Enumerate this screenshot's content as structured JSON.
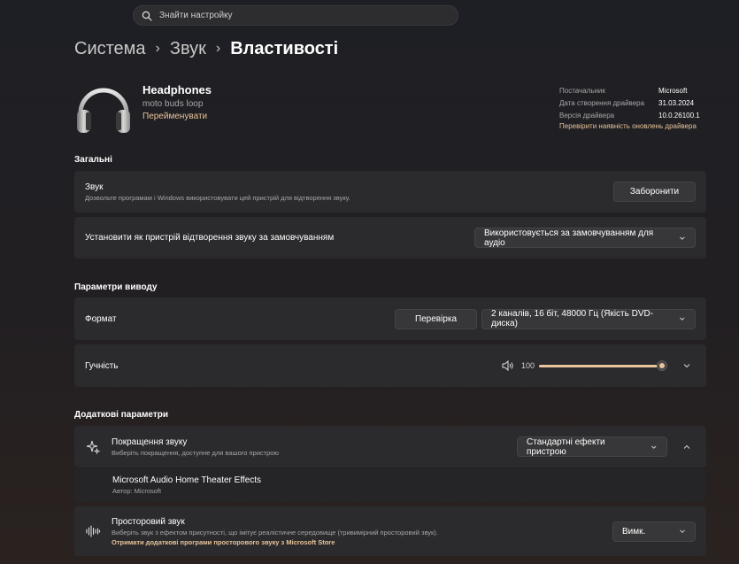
{
  "search": {
    "placeholder": "Знайти настройку"
  },
  "breadcrumb": {
    "level1": "Система",
    "level2": "Звук",
    "current": "Властивості"
  },
  "device": {
    "name": "Headphones",
    "model": "moto buds loop",
    "rename_link": "Перейменувати",
    "icon": "headphones-icon"
  },
  "driver": {
    "rows": [
      {
        "label": "Постачальник",
        "value": "Microsoft"
      },
      {
        "label": "Дата створення драйвера",
        "value": "31.03.2024"
      },
      {
        "label": "Версія драйвера",
        "value": "10.0.26100.1"
      }
    ],
    "update_link": "Перевірити наявність оновлень драйвера"
  },
  "general": {
    "title": "Загальні",
    "audio": {
      "title": "Звук",
      "desc": "Дозвольте програмам і Windows використовувати цей пристрій для відтворення звуку.",
      "button": "Заборонити"
    },
    "default_device": {
      "title": "Установити як пристрій відтворення звуку за замовчуванням",
      "value": "Використовується за замовчуванням для аудіо"
    }
  },
  "output": {
    "title": "Параметри виводу",
    "format": {
      "title": "Формат",
      "test_button": "Перевірка",
      "value": "2 каналів, 16 біт, 48000 Гц (Якість DVD-диска)"
    },
    "volume": {
      "title": "Гучність",
      "value": "100",
      "level": 100
    }
  },
  "additional": {
    "title": "Додаткові параметри",
    "enhancements": {
      "title": "Покращення звуку",
      "desc": "Виберіть покращення, доступне для вашого пристрою",
      "value": "Стандартні ефекти пристрою",
      "icon": "sparkle-icon"
    },
    "effects": {
      "title": "Microsoft Audio Home Theater Effects",
      "desc": "Автор: Microsoft"
    },
    "spatial": {
      "title": "Просторовий звук",
      "desc": "Виберіть звук з ефектом присутності, що імітує реалістичне середовище (тривимірний просторовий звук).",
      "link": "Отримати додаткові програми просторового звуку з Microsoft Store",
      "value": "Вимк.",
      "icon": "spatial-audio-icon"
    }
  },
  "colors": {
    "accent": "#e8c49a",
    "card": "#2b2a2c",
    "background": "#201f23"
  }
}
